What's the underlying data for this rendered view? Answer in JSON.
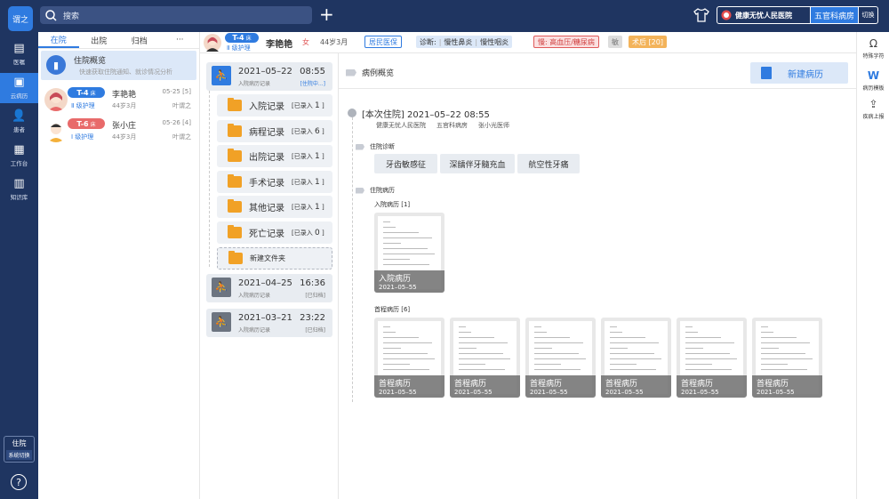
{
  "app": {
    "logo": "谓之",
    "search_placeholder": "搜索",
    "hospital": "健康无忧人民医院",
    "dept": "五官科病房",
    "switch": "切换"
  },
  "nav": [
    {
      "label": "医嘱",
      "icon": "clipboard-icon"
    },
    {
      "label": "云病历",
      "icon": "cloud-record-icon"
    },
    {
      "label": "患者",
      "icon": "people-icon"
    },
    {
      "label": "工作台",
      "icon": "desk-icon"
    },
    {
      "label": "知识库",
      "icon": "book-icon"
    }
  ],
  "system": {
    "label": "住院",
    "sub": "系统切换",
    "help": "?"
  },
  "tabs": [
    "在院",
    "出院",
    "归档",
    "···"
  ],
  "overview": {
    "title": "住院概览",
    "sub": "快速获取住院通知、就诊情况分析"
  },
  "patients": [
    {
      "bed": "T-4",
      "bed_unit": "床",
      "nurse": "Ⅱ 级护理",
      "name": "李艳艳",
      "age": "44岁3月",
      "date": "05-25 [5]",
      "doctor": "叶谓之",
      "bed_color": "#2f7be0",
      "nurse_color": "#2f7be0"
    },
    {
      "bed": "T-6",
      "bed_unit": "床",
      "nurse": "Ⅰ 级护理",
      "name": "张小庄",
      "age": "44岁3月",
      "date": "05-26 [4]",
      "doctor": "叶谓之",
      "bed_color": "#e86a6a",
      "nurse_color": "#2f7be0"
    }
  ],
  "header": {
    "bed": "T-4",
    "bed_unit": "床",
    "nurse": "Ⅱ 级护理",
    "name": "李艳艳",
    "sex": "女",
    "age": "44岁3月",
    "insurance": "居民医保",
    "diag_label": "诊断:",
    "diag1": "慢性鼻炎",
    "diag2": "慢性咽炎",
    "chronic": "慢: 高血压/糖尿病",
    "allergy": "敏",
    "postop": "术后 [20]"
  },
  "records": {
    "current": {
      "date": "2021–05–22",
      "time": "08:55",
      "sub": "入院病历记录",
      "status": "[住院中...]"
    },
    "folders": [
      {
        "name": "入院记录",
        "tag": "[已录入",
        "count": "1",
        "end": "]"
      },
      {
        "name": "病程记录",
        "tag": "[已录入",
        "count": "6",
        "end": "]"
      },
      {
        "name": "出院记录",
        "tag": "[已录入",
        "count": "1",
        "end": "]"
      },
      {
        "name": "手术记录",
        "tag": "[已录入",
        "count": "1",
        "end": "]"
      },
      {
        "name": "其他记录",
        "tag": "[已录入",
        "count": "1",
        "end": "]"
      },
      {
        "name": "死亡记录",
        "tag": "[已录入",
        "count": "0",
        "end": "]"
      }
    ],
    "new_folder": "新建文件夹",
    "past": [
      {
        "date": "2021–04–25",
        "time": "16:36",
        "sub": "入院病历记录",
        "status": "[已归档]"
      },
      {
        "date": "2021–03–21",
        "time": "23:22",
        "sub": "入院病历记录",
        "status": "[已归档]"
      }
    ]
  },
  "main": {
    "section": "病例概览",
    "new_record": "新建病历",
    "admission": "[本次住院] 2021–05–22    08:55",
    "hospital": "健康无忧人民医院",
    "dept": "五官科病房",
    "doctor": "张小光医师",
    "diag_title": "住院诊断",
    "diagnoses": [
      "牙齿敏感征",
      "深龋伴牙髓充血",
      "航空性牙痛"
    ],
    "history_title": "住院病历",
    "group1": "入院病历 [1]",
    "group2": "首程病历 [6]",
    "thumb1": {
      "title": "入院病历",
      "date": "2021–05–55"
    },
    "thumbs2": [
      {
        "title": "首程病历",
        "date": "2021–05–55"
      },
      {
        "title": "首程病历",
        "date": "2021–05–55"
      },
      {
        "title": "首程病历",
        "date": "2021–05–55"
      },
      {
        "title": "首程病历",
        "date": "2021–05–55"
      },
      {
        "title": "首程病历",
        "date": "2021–05–55"
      },
      {
        "title": "首程病历",
        "date": "2021–05–55"
      }
    ]
  },
  "rightbar": [
    {
      "label": "特殊字符",
      "icon": "omega-icon"
    },
    {
      "label": "病历模板",
      "icon": "word-doc-icon"
    },
    {
      "label": "疾病上报",
      "icon": "upload-icon"
    }
  ]
}
